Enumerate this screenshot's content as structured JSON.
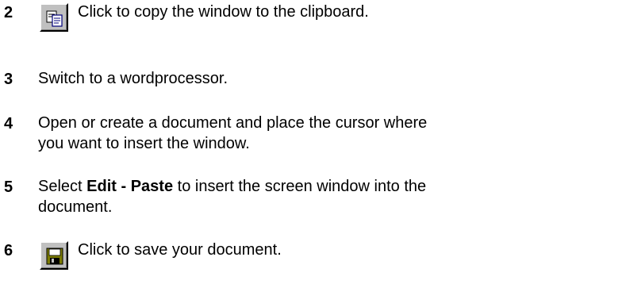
{
  "steps": [
    {
      "number": "2",
      "icon": "copy-icon",
      "text": "Click to copy the window to the clipboard."
    },
    {
      "number": "3",
      "text": "Switch to a wordprocessor."
    },
    {
      "number": "4",
      "line1": "Open or create a document and place the cursor where",
      "line2": "you want to insert the window."
    },
    {
      "number": "5",
      "prefix": "Select ",
      "bold": "Edit - Paste",
      "suffix": " to insert the screen window into the",
      "line2": "document."
    },
    {
      "number": "6",
      "icon": "save-icon",
      "text": "Click to save your document."
    }
  ]
}
